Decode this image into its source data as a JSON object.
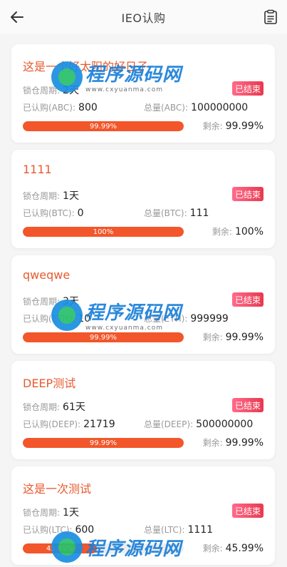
{
  "header": {
    "title": "IEO认购",
    "back_icon": "arrow-left-icon",
    "record_icon": "clipboard-list-icon"
  },
  "labels": {
    "lock_period": "锁仓周期:",
    "remaining": "剩余:"
  },
  "colors": {
    "accent": "#e8592f",
    "progress_fill": "#f2562a",
    "badge_start": "#ff6b8a",
    "badge_end": "#e8394f"
  },
  "items": [
    {
      "name": "这是一个好太阳的好日子",
      "lock": "2天",
      "status": "已结束",
      "subscribed_label": "已认购(ABC):",
      "subscribed": "800",
      "total_label": "总量(ABC):",
      "total": "100000000",
      "progress_text": "99.99%",
      "progress": 0.9999,
      "remaining": "99.99%"
    },
    {
      "name": "1111",
      "lock": "1天",
      "status": "已结束",
      "subscribed_label": "已认购(BTC):",
      "subscribed": "0",
      "total_label": "总量(BTC):",
      "total": "111",
      "progress_text": "100%",
      "progress": 1.0,
      "remaining": "100%"
    },
    {
      "name": "qweqwe",
      "lock": "3天",
      "status": "已结束",
      "subscribed_label": "已认购(ETH):",
      "subscribed": "10",
      "total_label": "总量(ETH):",
      "total": "999999",
      "progress_text": "99.99%",
      "progress": 0.9999,
      "remaining": "99.99%"
    },
    {
      "name": "DEEP测试",
      "lock": "61天",
      "status": "已结束",
      "subscribed_label": "已认购(DEEP):",
      "subscribed": "21719",
      "total_label": "总量(DEEP):",
      "total": "500000000",
      "progress_text": "99.99%",
      "progress": 0.9999,
      "remaining": "99.99%"
    },
    {
      "name": "这是一次测试",
      "lock": "1天",
      "status": "已结束",
      "subscribed_label": "已认购(LTC):",
      "subscribed": "600",
      "total_label": "总量(LTC):",
      "total": "1111",
      "progress_text": "45.99%",
      "progress": 0.4599,
      "remaining": "45.99%"
    }
  ],
  "watermark": {
    "cn": "程序源码网",
    "url": "www.cxyuanma.com"
  }
}
